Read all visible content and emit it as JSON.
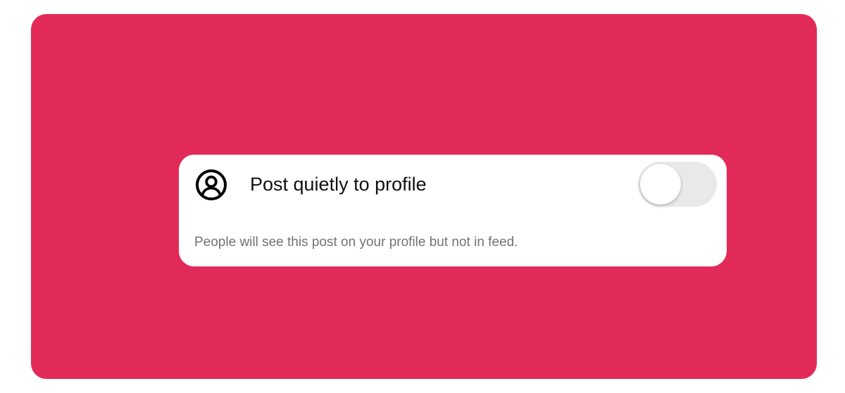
{
  "colors": {
    "backdrop": "#e22a59",
    "card": "#ffffff",
    "title_text": "#111111",
    "description_text": "#737373",
    "toggle_track_off": "#e9e9ea"
  },
  "setting": {
    "icon": "profile-circle-icon",
    "title": "Post quietly to profile",
    "description": "People will see this post on your profile but not in feed.",
    "toggle": {
      "state": "off"
    }
  }
}
